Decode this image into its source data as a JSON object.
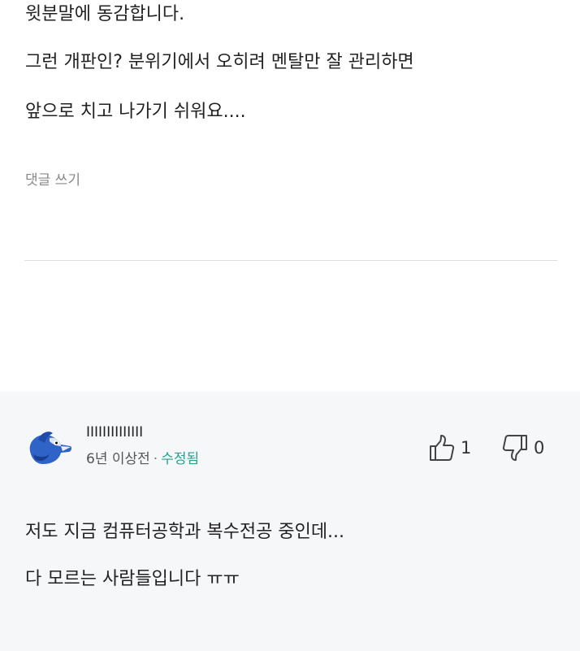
{
  "previous_comment": {
    "lines": [
      "윗분말에 동감합니다.",
      "그런 개판인? 분위기에서 오히려 멘탈만 잘 관리하면",
      "앞으로 치고 나가기 쉬워요...."
    ],
    "reply_label": "댓글 쓰기"
  },
  "comment": {
    "username": "IIIIIIIIIIIIII",
    "time": "6년 이상전",
    "separator": "·",
    "edited": "수정됨",
    "likes": "1",
    "dislikes": "0",
    "lines": [
      "저도 지금 컴퓨터공학과 복수전공 중인데...",
      "다 모르는 사람들입니다 ㅠㅠ"
    ]
  },
  "icons": {
    "avatar": "blue-bird-avatar",
    "like": "thumbs-up-icon",
    "dislike": "thumbs-down-icon"
  },
  "colors": {
    "edited": "#23a28f",
    "muted": "#888888",
    "comment_bg": "#f6f7f9",
    "avatar_blue": "#2f63c8"
  }
}
